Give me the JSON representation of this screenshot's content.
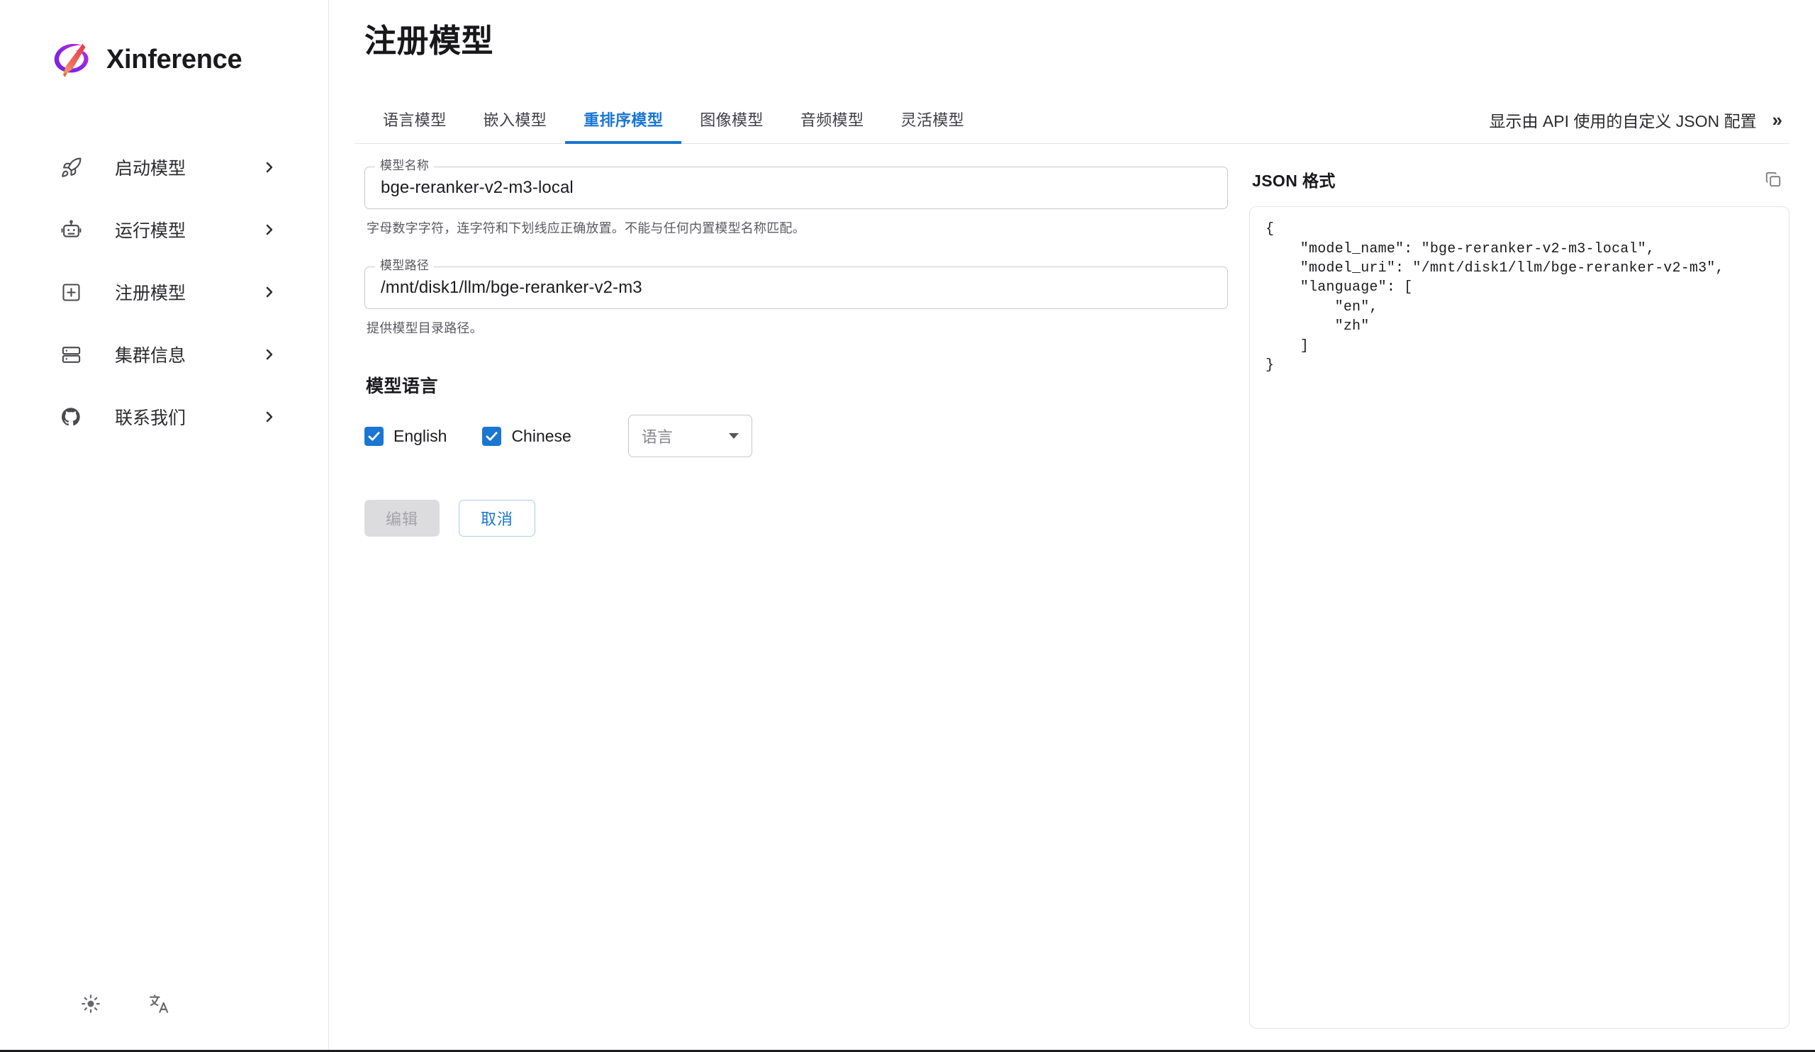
{
  "brand": {
    "name": "Xinference",
    "logo_icon": "xinference-logo-icon"
  },
  "sidebar": {
    "items": [
      {
        "label": "启动模型",
        "icon": "rocket-icon"
      },
      {
        "label": "运行模型",
        "icon": "robot-icon"
      },
      {
        "label": "注册模型",
        "icon": "plus-square-icon"
      },
      {
        "label": "集群信息",
        "icon": "server-icon"
      },
      {
        "label": "联系我们",
        "icon": "github-icon"
      }
    ],
    "footer": [
      {
        "icon": "sun-icon",
        "name": "theme-toggle"
      },
      {
        "icon": "translate-icon",
        "name": "language-toggle"
      }
    ]
  },
  "header": {
    "page_title": "注册模型"
  },
  "tabs": {
    "items": [
      {
        "label": "语言模型",
        "active": false
      },
      {
        "label": "嵌入模型",
        "active": false
      },
      {
        "label": "重排序模型",
        "active": true
      },
      {
        "label": "图像模型",
        "active": false
      },
      {
        "label": "音频模型",
        "active": false
      },
      {
        "label": "灵活模型",
        "active": false
      }
    ],
    "active_index": 2,
    "accent_color": "#1976d2"
  },
  "api_toggle": {
    "label": "显示由 API 使用的自定义 JSON 配置",
    "chevron": "»"
  },
  "form": {
    "model_name": {
      "label": "模型名称",
      "value": "bge-reranker-v2-m3-local",
      "placeholder": "",
      "helper": "字母数字字符，连字符和下划线应正确放置。不能与任何内置模型名称匹配。"
    },
    "model_path": {
      "label": "模型路径",
      "value": "/mnt/disk1/llm/bge-reranker-v2-m3",
      "placeholder": "",
      "helper": "提供模型目录路径。"
    },
    "language_section": {
      "title": "模型语言",
      "checkboxes": [
        {
          "label": "English",
          "checked": true
        },
        {
          "label": "Chinese",
          "checked": true
        }
      ],
      "select": {
        "value": "语言",
        "placeholder": "语言",
        "options": [
          "语言"
        ]
      }
    },
    "buttons": [
      {
        "label": "编辑",
        "style": "disabled",
        "name": "edit-button"
      },
      {
        "label": "取消",
        "style": "outline",
        "name": "cancel-button"
      }
    ]
  },
  "json_panel": {
    "title": "JSON 格式",
    "copy_icon": "copy-icon",
    "code": "{\n    \"model_name\": \"bge-reranker-v2-m3-local\",\n    \"model_uri\": \"/mnt/disk1/llm/bge-reranker-v2-m3\",\n    \"language\": [\n        \"en\",\n        \"zh\"\n    ]\n}"
  },
  "colors": {
    "accent": "#1976d2",
    "text": "#1c1c1f",
    "muted": "#5a5a61",
    "border": "#e4e4e7"
  }
}
